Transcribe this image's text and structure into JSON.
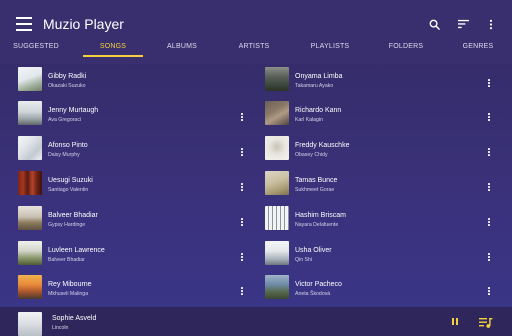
{
  "app": {
    "title": "Muzio Player"
  },
  "toolbar": {
    "menu_icon": "menu-icon",
    "search_icon": "search-icon",
    "sort_icon": "sort-icon",
    "more_icon": "more-vert-icon"
  },
  "colors": {
    "accent": "#f3d13c",
    "appbar": "#3a2f6e",
    "background": "#362e6f",
    "now_playing_bar": "#2f265c"
  },
  "tabs": [
    {
      "label": "SUGGESTED",
      "active": false
    },
    {
      "label": "SONGS",
      "active": true
    },
    {
      "label": "ALBUMS",
      "active": false
    },
    {
      "label": "ARTISTS",
      "active": false
    },
    {
      "label": "PLAYLISTS",
      "active": false
    },
    {
      "label": "FOLDERS",
      "active": false
    },
    {
      "label": "GENRES",
      "active": false
    }
  ],
  "songs": [
    {
      "title": "Gibby Radki",
      "artist": "Okazaki Suzuko"
    },
    {
      "title": "Onyama Limba",
      "artist": "Takamaru Ayako"
    },
    {
      "title": "Jenny Murtaugh",
      "artist": "Ava Gregoraci"
    },
    {
      "title": "Richardo Kann",
      "artist": "Karl Kalagin"
    },
    {
      "title": "Afonso Pinto",
      "artist": "Daisy Murphy"
    },
    {
      "title": "Freddy Kauschke",
      "artist": "Obasey Chidy"
    },
    {
      "title": "Uesugi Suzuki",
      "artist": "Santiago Valentin"
    },
    {
      "title": "Tamas Bunce",
      "artist": "Sukhmeet Gorae"
    },
    {
      "title": "Balveer Bhadiar",
      "artist": "Gypsy Hardinge"
    },
    {
      "title": "Hashim Briscam",
      "artist": "Nayara Delafuente"
    },
    {
      "title": "Luvleen Lawrence",
      "artist": "Balveer Bhadiar"
    },
    {
      "title": "Usha Oliver",
      "artist": "Qin Shi"
    },
    {
      "title": "Rey Mibourne",
      "artist": "Mkhuseli Malinga"
    },
    {
      "title": "Victor Pacheco",
      "artist": "Aneta Škodová"
    }
  ],
  "now_playing": {
    "title": "Sophie Asveld",
    "artist": "Lincoln",
    "pause_icon": "pause-icon",
    "queue_icon": "queue-music-icon"
  }
}
